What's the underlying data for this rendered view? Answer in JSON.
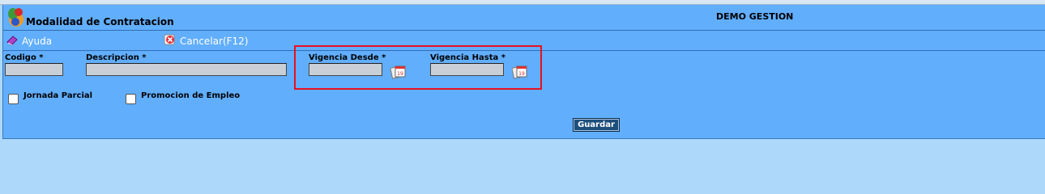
{
  "header": {
    "form_title": "Modalidad de Contratacion",
    "company": "DEMO GESTION"
  },
  "toolbar": {
    "help_label": "Ayuda",
    "cancel_label": "Cancelar(F12)"
  },
  "fields": {
    "codigo": {
      "label": "Codigo *",
      "value": ""
    },
    "descripcion": {
      "label": "Descripcion *",
      "value": ""
    },
    "vigencia_desde": {
      "label": "Vigencia Desde *",
      "value": ""
    },
    "vigencia_hasta": {
      "label": "Vigencia Hasta *",
      "value": ""
    }
  },
  "checkboxes": {
    "jornada_parcial": {
      "label": "Jornada Parcial",
      "checked": false
    },
    "promocion_empleo": {
      "label": "Promocion de Empleo",
      "checked": false
    }
  },
  "actions": {
    "save_label": "Guardar"
  },
  "colors": {
    "panel": "#61aefd",
    "page_background": "#add8fa",
    "highlight": "#e8101e",
    "save_button": "#1e4f7c"
  },
  "icons": {
    "logo": "app-logo-icon",
    "help": "help-book-icon",
    "cancel": "cancel-icon",
    "calendar": "calendar-icon"
  }
}
